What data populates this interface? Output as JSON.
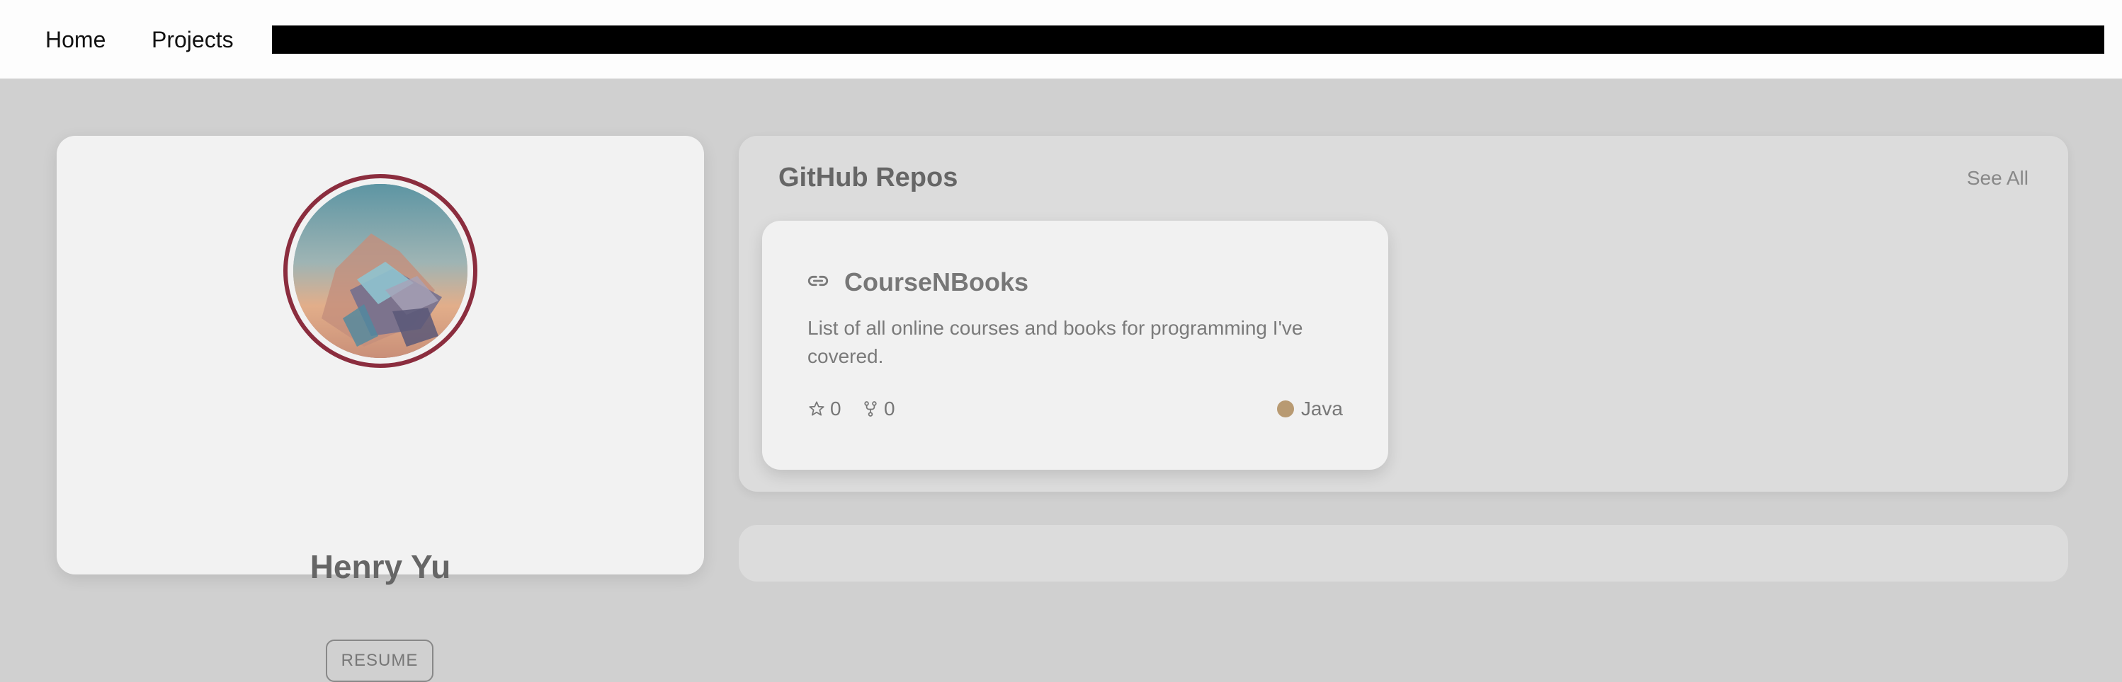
{
  "nav": {
    "home": "Home",
    "projects": "Projects"
  },
  "profile": {
    "name": "Henry Yu",
    "resume_label": "RESUME",
    "avatar_ring_color": "#8b2d3e"
  },
  "repos": {
    "title": "GitHub Repos",
    "see_all": "See All",
    "items": [
      {
        "name": "CourseNBooks",
        "description": "List of all online courses and books for programming I've covered.",
        "stars": "0",
        "forks": "0",
        "language": "Java",
        "language_color": "#b89a72",
        "icon": "link-icon"
      }
    ]
  }
}
